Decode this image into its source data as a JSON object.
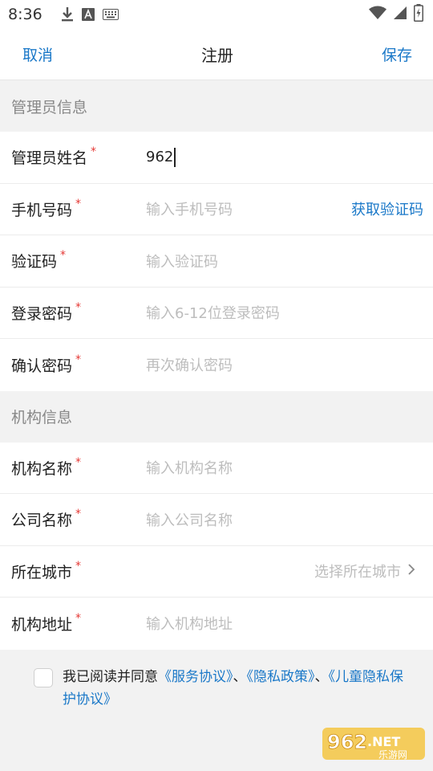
{
  "status": {
    "time": "8:36",
    "left_icons": [
      "download-icon",
      "text-a-icon",
      "keyboard-icon"
    ],
    "right_icons": [
      "wifi-icon",
      "signal-icon",
      "battery-charging-icon"
    ]
  },
  "nav": {
    "cancel": "取消",
    "title": "注册",
    "save": "保存"
  },
  "admin_section": {
    "header": "管理员信息",
    "rows": [
      {
        "label": "管理员姓名",
        "required": "*",
        "value": "962",
        "placeholder": ""
      },
      {
        "label": "手机号码",
        "required": "*",
        "value": "",
        "placeholder": "输入手机号码",
        "action": "获取验证码"
      },
      {
        "label": "验证码",
        "required": "*",
        "value": "",
        "placeholder": "输入验证码"
      },
      {
        "label": "登录密码",
        "required": "*",
        "value": "",
        "placeholder": "输入6-12位登录密码"
      },
      {
        "label": "确认密码",
        "required": "*",
        "value": "",
        "placeholder": "再次确认密码"
      }
    ]
  },
  "org_section": {
    "header": "机构信息",
    "rows": [
      {
        "label": "机构名称",
        "required": "*",
        "placeholder": "输入机构名称"
      },
      {
        "label": "公司名称",
        "required": "*",
        "placeholder": "输入公司名称"
      },
      {
        "label": "所在城市",
        "required": "*",
        "placeholder": "选择所在城市"
      },
      {
        "label": "机构地址",
        "required": "*",
        "placeholder": "输入机构地址"
      }
    ]
  },
  "agreement": {
    "prefix": "我已阅读并同意",
    "service": "《服务协议》",
    "sep1": "、",
    "privacy": "《隐私政策》",
    "sep2": "、",
    "child_privacy": "《儿童隐私保护协议》"
  },
  "watermark": {
    "brand_number": "962",
    "brand_suffix": ".NET",
    "brand_cn": "乐游网"
  },
  "colors": {
    "accent": "#1a78c8",
    "required": "#e53935",
    "placeholder": "#bdbdbd",
    "background": "#f2f2f2"
  }
}
